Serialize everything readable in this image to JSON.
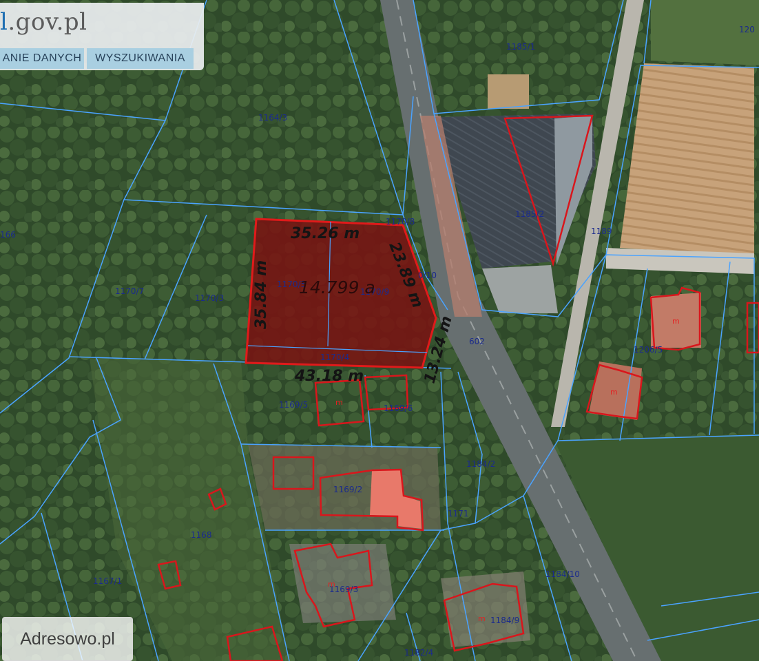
{
  "header": {
    "logo_accent": "l",
    "logo_text": ".gov.pl",
    "nav": [
      "ANIE DANYCH",
      "WYSZUKIWANIA"
    ]
  },
  "map": {
    "selected_parcel": {
      "area": "14.799 a",
      "dimensions": [
        "35.26 m",
        "23.89 m",
        "35.84 m",
        "13.24 m",
        "43.18 m"
      ]
    },
    "parcel_ids": [
      "1185/1",
      "120",
      "1164/3",
      "1185/2",
      "1189",
      "166",
      "1170/8",
      "1170/7",
      "1170/3",
      "1170/5",
      "1170/9",
      "0/10",
      "1170/4",
      "602",
      "1206/5",
      "1169/5",
      "1169/6",
      "1184/2",
      "1169/2",
      "1171",
      "1168",
      "1167/1",
      "1184/10",
      "1169/3",
      "1184/9",
      "1182/4"
    ],
    "building_marker": "m",
    "colors": {
      "parcel_boundary": "#4aa3ff",
      "building_outline": "#d9161c",
      "selection_fill": "#7a1212",
      "selection_outline": "#e01a1a",
      "parcel_label": "#1b2b8c"
    }
  },
  "watermark": "Adresowo.pl"
}
